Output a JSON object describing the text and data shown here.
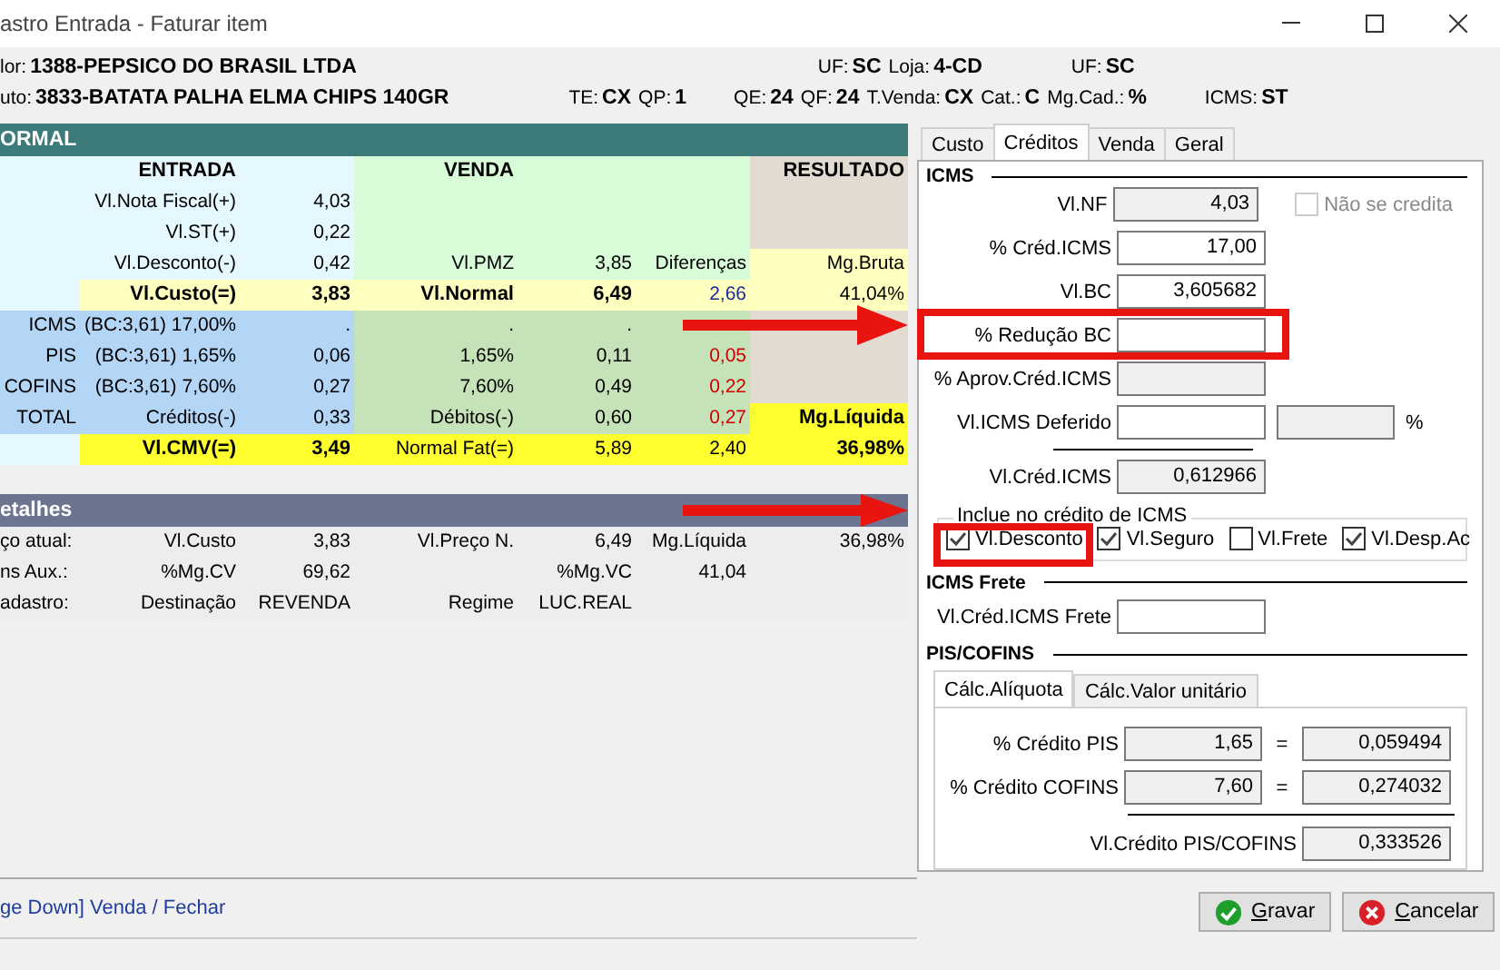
{
  "window": {
    "title": "astro Entrada - Faturar item"
  },
  "info_lines": [
    [
      {
        "label": "lor:",
        "value": "1388-PEPSICO DO BRASIL LTDA"
      },
      {
        "label": "UF:",
        "value": "SC"
      },
      {
        "label": "Loja:",
        "value": "4-CD"
      },
      {
        "label": "UF:",
        "value": "SC"
      }
    ],
    [
      {
        "label": "uto:",
        "value": "3833-BATATA PALHA ELMA CHIPS 140GR"
      },
      {
        "label": "TE:",
        "value": "CX"
      },
      {
        "label": "QP:",
        "value": "1"
      },
      {
        "label": "QE:",
        "value": "24"
      },
      {
        "label": "QF:",
        "value": "24"
      },
      {
        "label": "T.Venda:",
        "value": "CX"
      },
      {
        "label": "Cat.:",
        "value": "C"
      },
      {
        "label": "Mg.Cad.:",
        "value": "%"
      },
      {
        "label": "ICMS:",
        "value": "ST"
      }
    ]
  ],
  "summary": {
    "title": "ORMAL",
    "rows": [
      {
        "kind": "header",
        "cells": [
          null,
          "ENTRADA",
          null,
          "VENDA",
          null,
          null,
          "RESULTADO"
        ]
      },
      {
        "kind": "plain",
        "cells": [
          null,
          "Vl.Nota Fiscal(+)",
          "4,03",
          null,
          null,
          null,
          null
        ]
      },
      {
        "kind": "plain",
        "cells": [
          null,
          "Vl.ST(+)",
          "0,22",
          null,
          null,
          null,
          null
        ]
      },
      {
        "kind": "margin",
        "cells": [
          null,
          "Vl.Desconto(-)",
          "0,42",
          "Vl.PMZ",
          "3,85",
          "Diferenças",
          "Mg.Bruta"
        ]
      },
      {
        "kind": "subtotal",
        "cells": [
          null,
          "Vl.Custo(=)",
          "3,83",
          "Vl.Normal",
          "6,49",
          "2,66",
          "41,04%"
        ]
      },
      {
        "kind": "tax",
        "cells": [
          "ICMS",
          "(BC:3,61) 17,00%",
          ".",
          ".",
          ".",
          null,
          null
        ]
      },
      {
        "kind": "tax",
        "cells": [
          "PIS",
          "(BC:3,61) 1,65%",
          "0,06",
          "1,65%",
          "0,11",
          "0,05",
          null
        ]
      },
      {
        "kind": "tax",
        "cells": [
          "COFINS",
          "(BC:3,61) 7,60%",
          "0,27",
          "7,60%",
          "0,49",
          "0,22",
          null
        ]
      },
      {
        "kind": "total",
        "cells": [
          "TOTAL",
          "Créditos(-)",
          "0,33",
          "Débitos(-)",
          "0,60",
          "0,27",
          "Mg.Líquida"
        ]
      },
      {
        "kind": "final",
        "cells": [
          null,
          "Vl.CMV(=)",
          "3,49",
          "Normal Fat(=)",
          "5,89",
          "2,40",
          "36,98%"
        ]
      }
    ]
  },
  "details": {
    "title": "etalhes",
    "rows": [
      [
        "ço atual:",
        "Vl.Custo",
        "3,83",
        "Vl.Preço N.",
        "6,49",
        "Mg.Líquida",
        "36,98%"
      ],
      [
        "ns Aux.:",
        "%Mg.CV",
        "69,62",
        null,
        "%Mg.VC",
        "41,04",
        null
      ],
      [
        "adastro:",
        "Destinação",
        "REVENDA",
        "Regime",
        "LUC.REAL",
        null,
        null
      ]
    ]
  },
  "status_text": "ge Down] Venda / Fechar",
  "panel_tabs": [
    {
      "label": "Custo",
      "selected": false
    },
    {
      "label": "Créditos",
      "selected": true
    },
    {
      "label": "Venda",
      "selected": false
    },
    {
      "label": "Geral",
      "selected": false
    }
  ],
  "icms": {
    "title": "ICMS",
    "fields": [
      {
        "label": "Vl.NF",
        "value": "4,03",
        "kind": "readonly",
        "checkbox": {
          "label": "Não se credita",
          "checked": false,
          "disabled": true
        }
      },
      {
        "label": "% Créd.ICMS",
        "value": "17,00",
        "kind": "editable"
      },
      {
        "label": "Vl.BC",
        "value": "3,605682",
        "kind": "editable"
      },
      {
        "label": "% Redução BC",
        "kind": "editable"
      },
      {
        "label": "% Aprov.Créd.ICMS",
        "kind": "readonly"
      },
      {
        "label": "Vl.ICMS Deferido",
        "kind": "editable",
        "extra": {
          "kind": "readonly",
          "suffix": "%"
        }
      },
      {
        "label": "Vl.Créd.ICMS",
        "value": "0,612966",
        "kind": "readonly",
        "divider_before": true
      }
    ]
  },
  "include": {
    "title": "Inclue no crédito de ICMS",
    "options": [
      {
        "label": "Vl.Desconto",
        "checked": true
      },
      {
        "label": "Vl.Seguro",
        "checked": true
      },
      {
        "label": "Vl.Frete",
        "checked": false
      },
      {
        "label": "Vl.Desp.Ac",
        "checked": true
      }
    ]
  },
  "icms_freight": {
    "title": "ICMS Frete",
    "fields": [
      {
        "label": "Vl.Créd.ICMS Frete",
        "kind": "editable"
      }
    ]
  },
  "pis_cofins": {
    "title": "PIS/COFINS",
    "tabs": [
      {
        "label": "Cálc.Alíquota",
        "selected": true
      },
      {
        "label": "Cálc.Valor unitário",
        "selected": false
      }
    ],
    "rows": [
      {
        "label": "% Crédito PIS",
        "rate": "1,65",
        "equals": "=",
        "result": "0,059494"
      },
      {
        "label": "% Crédito COFINS",
        "rate": "7,60",
        "equals": "=",
        "result": "0,274032"
      }
    ],
    "total": {
      "label": "Vl.Crédito PIS/COFINS",
      "value": "0,333526"
    }
  },
  "buttons": [
    {
      "label": "Gravar",
      "kind": "save"
    },
    {
      "label": "Cancelar",
      "kind": "cancel"
    }
  ]
}
